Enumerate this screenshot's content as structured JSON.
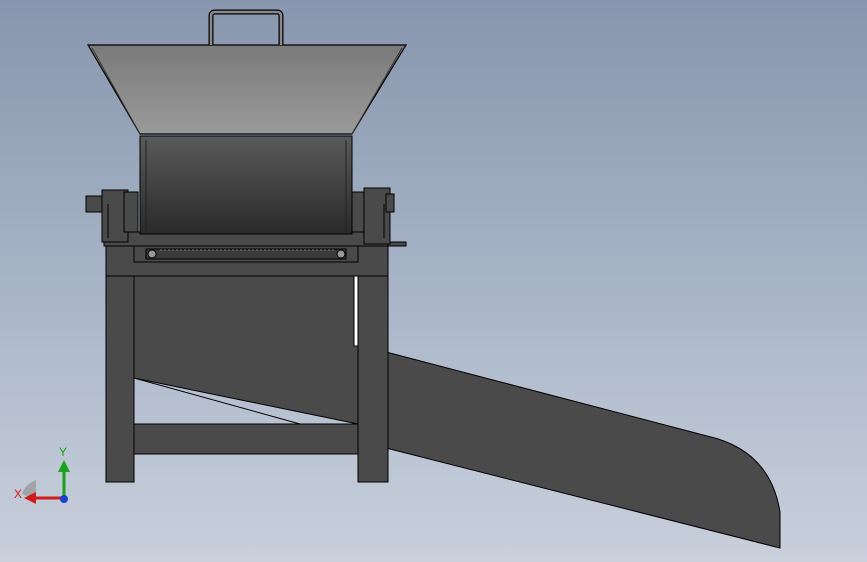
{
  "viewport": {
    "background_top": "#8796ae",
    "background_bottom": "#c9d0dc"
  },
  "model": {
    "part_fill": "#4a4a4a",
    "hopper_fill": "#8a8a8a",
    "outline": "#000000"
  },
  "triad": {
    "x_label": "X",
    "y_label": "Y",
    "x_color": "#d11b1b",
    "y_color": "#1aa31a",
    "z_color": "#1b3fd1"
  }
}
